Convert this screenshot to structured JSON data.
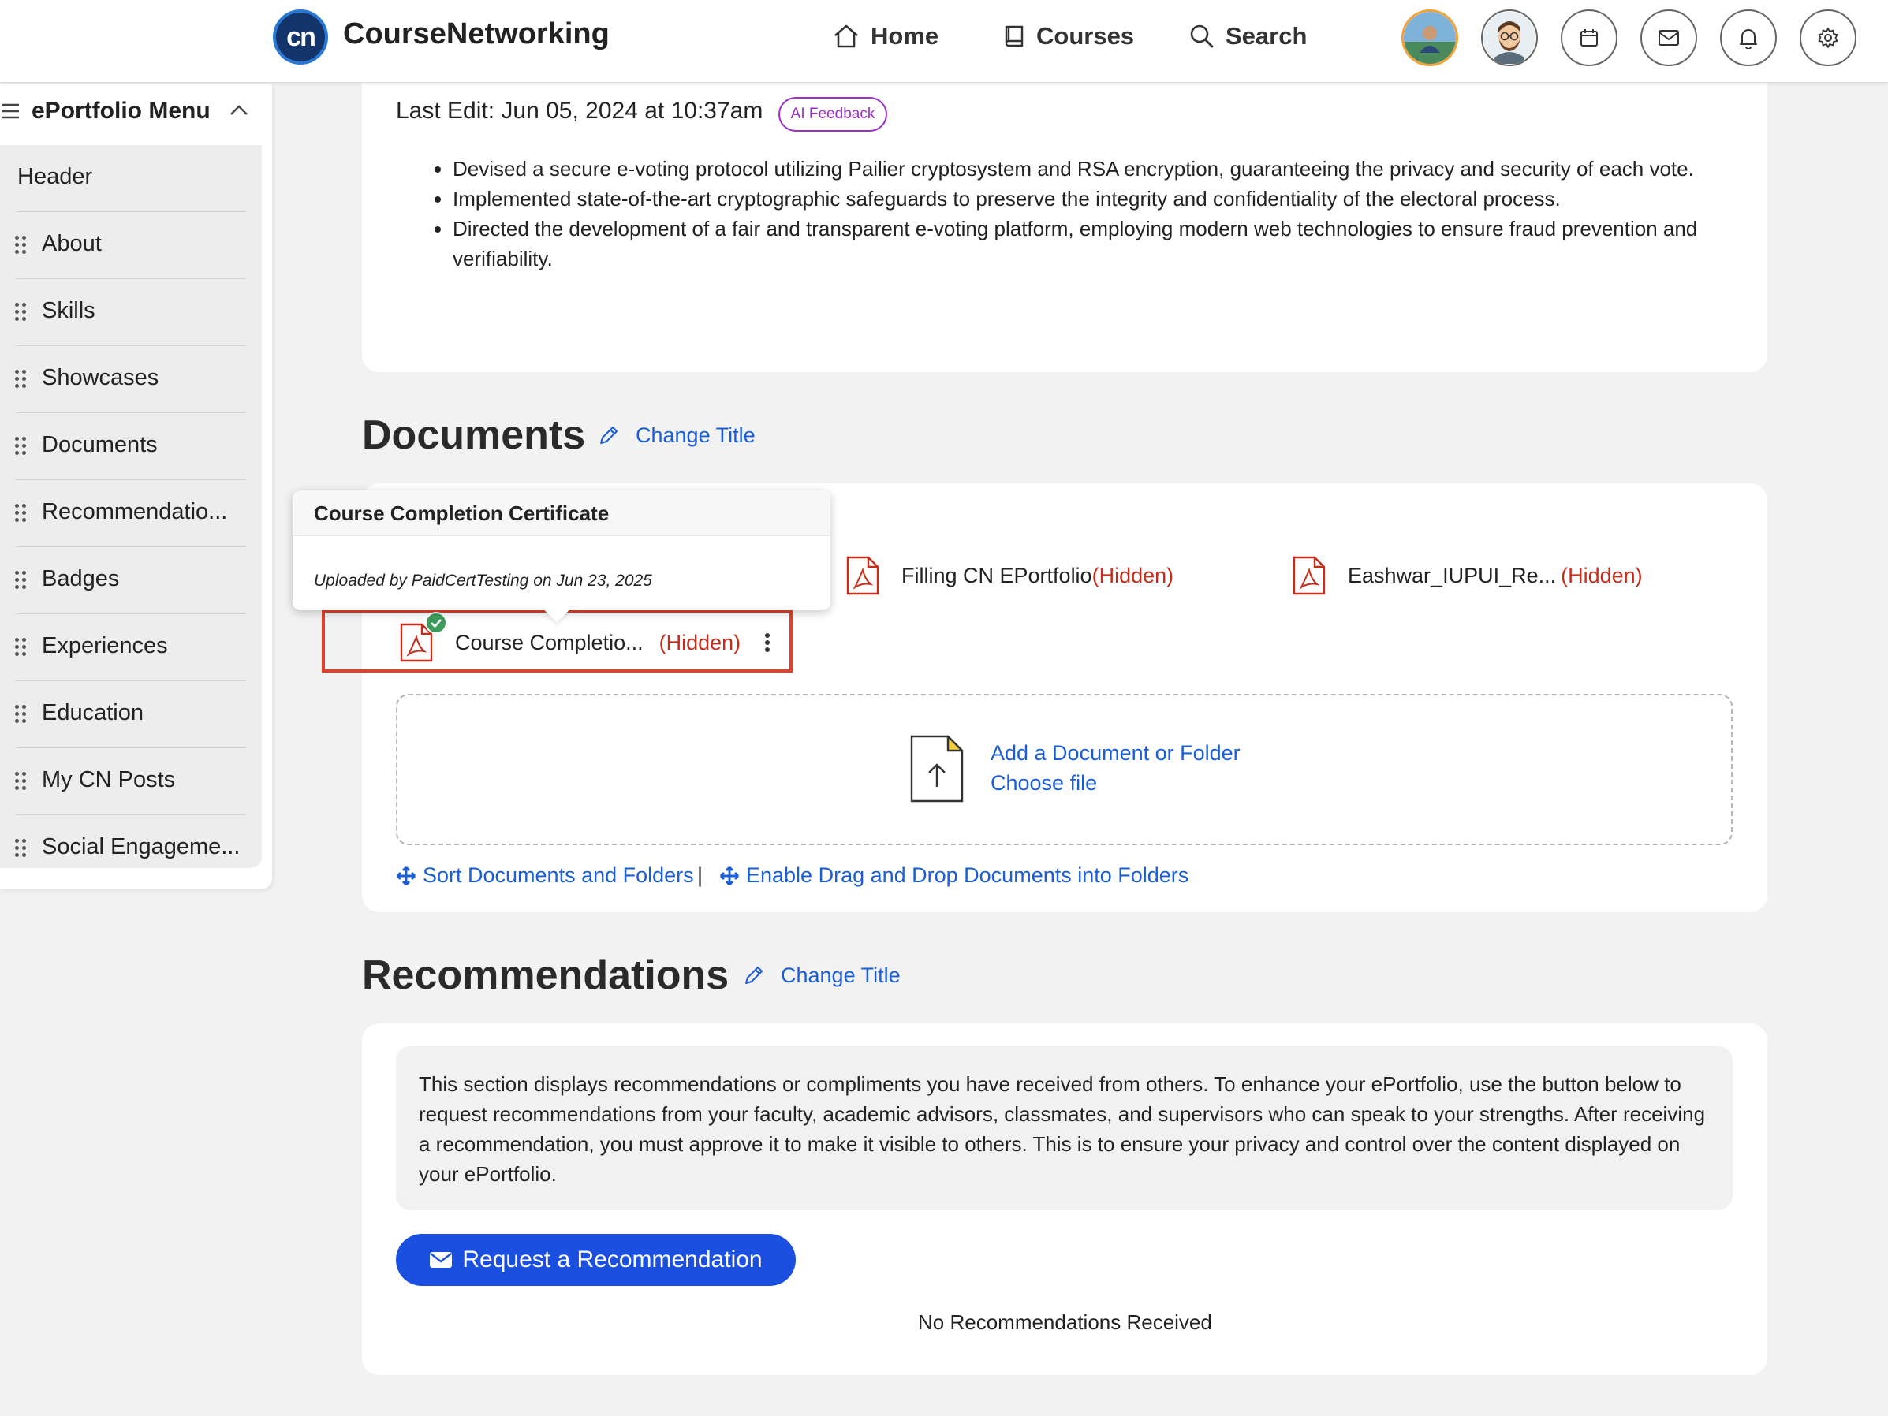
{
  "app": {
    "logo_text": "cn",
    "brand": "CourseNetworking"
  },
  "nav": {
    "home": "Home",
    "courses": "Courses",
    "search": "Search"
  },
  "header_icons": [
    "user-avatar",
    "profile-avatar",
    "calendar-icon",
    "mail-icon",
    "bell-icon",
    "settings-icon"
  ],
  "sidebar": {
    "title": "ePortfolio Menu",
    "items": [
      {
        "label": "Header",
        "draggable": false
      },
      {
        "label": "About",
        "draggable": true
      },
      {
        "label": "Skills",
        "draggable": true
      },
      {
        "label": "Showcases",
        "draggable": true
      },
      {
        "label": "Documents",
        "draggable": true
      },
      {
        "label": "Recommendatio...",
        "draggable": true
      },
      {
        "label": "Badges",
        "draggable": true
      },
      {
        "label": "Experiences",
        "draggable": true
      },
      {
        "label": "Education",
        "draggable": true
      },
      {
        "label": "My CN Posts",
        "draggable": true
      },
      {
        "label": "Social Engageme...",
        "draggable": true
      }
    ]
  },
  "project": {
    "last_edit": "Last Edit: Jun 05, 2024 at 10:37am",
    "ai_feedback": "AI Feedback",
    "bullets": [
      "Devised a secure e-voting protocol utilizing Pailier cryptosystem and RSA encryption, guaranteeing the privacy and security of each vote.",
      "Implemented state-of-the-art cryptographic safeguards to preserve the integrity and confidentiality of the electoral process.",
      "Directed the development of a fair and transparent e-voting platform, employing modern web technologies to ensure fraud prevention and verifiability."
    ]
  },
  "documents": {
    "title": "Documents",
    "change_title": "Change Title",
    "tooltip": {
      "title": "Course Completion Certificate",
      "uploaded": "Uploaded by PaidCertTesting on Jun 23, 2025"
    },
    "files": [
      {
        "name": "Filling CN EPortfolio",
        "status": "(Hidden)"
      },
      {
        "name": "Eashwar_IUPUI_Re...",
        "status": "(Hidden)"
      },
      {
        "name": "Course Completio...",
        "status": "(Hidden)"
      }
    ],
    "add": "Add a Document or Folder",
    "choose": "Choose file",
    "sort": "Sort Documents and Folders",
    "separator": "|",
    "dragdrop": "Enable Drag and Drop Documents into Folders"
  },
  "recommendations": {
    "title": "Recommendations",
    "change_title": "Change Title",
    "info": "This section displays recommendations or compliments you have received from others. To enhance your ePortfolio, use the button below to request recommendations from your faculty, academic advisors, classmates, and supervisors who can speak to your strengths. After receiving a recommendation, you must approve it to make it visible to others. This is to ensure your privacy and control over the content displayed on your ePortfolio.",
    "button": "Request a Recommendation",
    "empty": "No Recommendations Received"
  },
  "colors": {
    "accent": "#1a5ed6",
    "hidden": "#c62e1c",
    "highlight": "#e0412a",
    "ai_badge": "#9b2fc9",
    "success": "#3b9c5a"
  }
}
